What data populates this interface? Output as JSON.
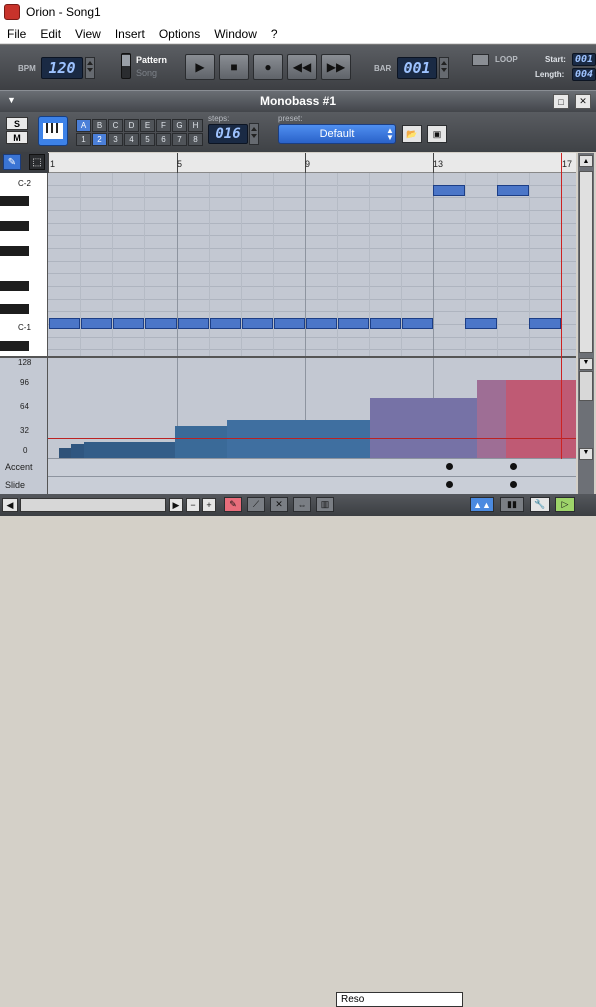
{
  "window": {
    "title": "Orion - Song1"
  },
  "menu": [
    "File",
    "Edit",
    "View",
    "Insert",
    "Options",
    "Window",
    "?"
  ],
  "transport": {
    "bpm_label": "BPM",
    "bpm_value": "120",
    "pattern_label": "Pattern",
    "song_label": "Song",
    "bar_label": "BAR",
    "bar_value": "001",
    "loop_label": "LOOP",
    "start_label": "Start:",
    "start_value": "001",
    "length_label": "Length:",
    "length_value": "004"
  },
  "plugin": {
    "title": "Monobass #1",
    "s_label": "S",
    "m_label": "M",
    "pattern_letters": [
      "A",
      "B",
      "C",
      "D",
      "E",
      "F",
      "G",
      "H"
    ],
    "pattern_numbers": [
      "1",
      "2",
      "3",
      "4",
      "5",
      "6",
      "7",
      "8"
    ],
    "steps_label": "steps:",
    "steps_value": "016",
    "preset_label": "preset:",
    "preset_value": "Default"
  },
  "ruler": [
    "1",
    "5",
    "9",
    "13",
    "17"
  ],
  "keys": {
    "c2": "C-2",
    "c1": "C-1"
  },
  "velocity_scale": [
    "128",
    "96",
    "64",
    "32",
    "0"
  ],
  "lanes": {
    "accent": "Accent",
    "slide": "Slide"
  },
  "bottom": {
    "param_select": "Reso"
  },
  "colors": {
    "accent_blue": "#4b76c8",
    "playhead": "#cc2222",
    "lcd_text": "#9ec3ff"
  },
  "icons": [
    "app-icon",
    "pencil-icon",
    "select-icon",
    "piano-icon",
    "folder-icon",
    "save-icon",
    "play-icon",
    "stop-icon",
    "record-icon",
    "rewind-icon",
    "fast-forward-icon"
  ]
}
